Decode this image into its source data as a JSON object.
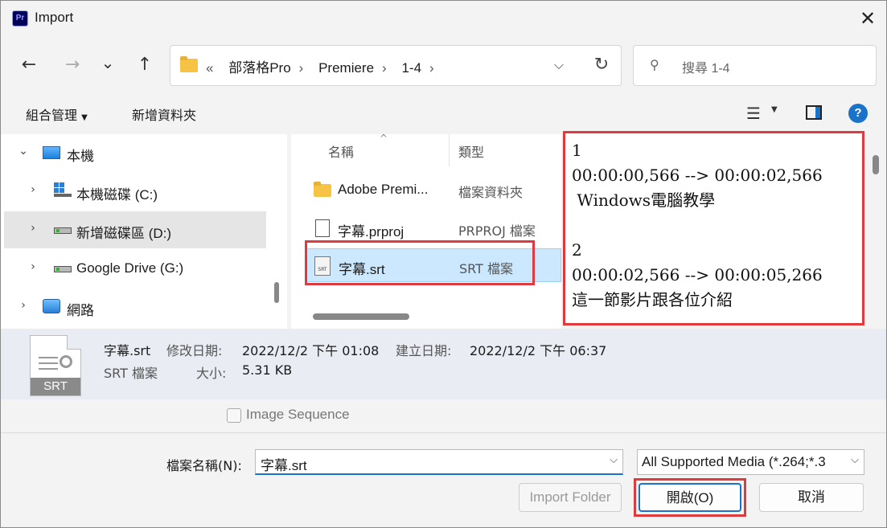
{
  "window": {
    "title": "Import",
    "app_icon_text": "Pr"
  },
  "nav": {
    "back": "←",
    "forward": "→",
    "recent": "⌄",
    "up": "↑",
    "breadcrumb_prefix": "«",
    "breadcrumb": [
      "部落格Pro",
      "Premiere",
      "1-4"
    ],
    "search_placeholder": "搜尋 1-4"
  },
  "toolbar": {
    "organize": "組合管理",
    "new_folder": "新增資料夾"
  },
  "tree": {
    "items": [
      {
        "label": "本機"
      },
      {
        "label": "本機磁碟 (C:)"
      },
      {
        "label": "新增磁碟區 (D:)"
      },
      {
        "label": "Google Drive (G:)"
      },
      {
        "label": "網路"
      }
    ]
  },
  "files": {
    "columns": [
      "名稱",
      "類型"
    ],
    "rows": [
      {
        "name": "Adobe Premi...",
        "type": "檔案資料夾",
        "icon": "folder-icon"
      },
      {
        "name": "字幕.prproj",
        "type": "PRPROJ 檔案",
        "icon": "document-icon"
      },
      {
        "name": "字幕.srt",
        "type": "SRT 檔案",
        "icon": "srt-file-icon",
        "selected": true
      }
    ]
  },
  "preview": {
    "lines": [
      "1",
      "00:00:00,566 --> 00:00:02,566",
      " Windows電腦教學",
      "",
      "2",
      "00:00:02,566 --> 00:00:05,266",
      "這一節影片跟各位介紹"
    ]
  },
  "details": {
    "file_name": "字幕.srt",
    "file_type": "SRT 檔案",
    "modified_label": "修改日期:",
    "modified_value": "2022/12/2 下午 01:08",
    "created_label": "建立日期:",
    "created_value": "2022/12/2 下午 06:37",
    "size_label": "大小:",
    "size_value": "5.31 KB",
    "icon_label": "SRT"
  },
  "bottom": {
    "image_sequence": "Image Sequence",
    "filename_label": "檔案名稱(N):",
    "filename_value": "字幕.srt",
    "filter_value": "All Supported Media (*.264;*.3",
    "import_folder": "Import Folder",
    "open": "開啟(O)",
    "cancel": "取消"
  },
  "colors": {
    "accent": "#1a73c9",
    "highlight_box": "#e0393e",
    "selection": "#cce8ff"
  }
}
